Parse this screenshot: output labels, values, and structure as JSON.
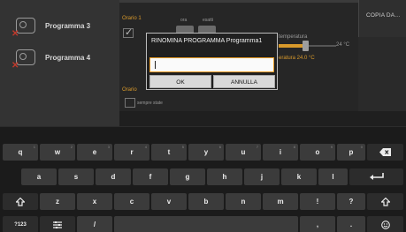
{
  "programs": [
    {
      "name": "Programma 3"
    },
    {
      "name": "Programma 4"
    }
  ],
  "settings": {
    "orario1_label": "Orario 1",
    "ora_label": "ora",
    "esatti_label": "esatti",
    "temperatura_label": "temperatura",
    "temp_value": "24 °C",
    "temperatura_value_label": "eratura 24.0 °C",
    "orario2_label": "Orario",
    "schedule_label": "sempre state"
  },
  "copy_button": {
    "label": "COPIA DA..."
  },
  "dialog": {
    "title": "RINOMINA PROGRAMMA Programma1",
    "input_value": "",
    "ok_label": "OK",
    "cancel_label": "ANNULLA"
  },
  "keyboard": {
    "row1": [
      {
        "k": "q",
        "h": "1"
      },
      {
        "k": "w",
        "h": "2"
      },
      {
        "k": "e",
        "h": "3"
      },
      {
        "k": "r",
        "h": "4"
      },
      {
        "k": "t",
        "h": "5"
      },
      {
        "k": "y",
        "h": "6"
      },
      {
        "k": "u",
        "h": "7"
      },
      {
        "k": "i",
        "h": "8"
      },
      {
        "k": "o",
        "h": "9"
      },
      {
        "k": "p",
        "h": "0"
      }
    ],
    "row2": [
      "a",
      "s",
      "d",
      "f",
      "g",
      "h",
      "j",
      "k",
      "l"
    ],
    "row3": [
      "z",
      "x",
      "c",
      "v",
      "b",
      "n",
      "m",
      "!",
      "?"
    ],
    "symbols_label": "?123",
    "slash_label": "/",
    "comma_label": ",",
    "period_label": "."
  },
  "icons": {
    "backspace": "backspace-icon",
    "enter": "enter-icon",
    "shift": "shift-icon",
    "emoji": "emoji-icon",
    "settings": "keyboard-settings-icon",
    "program": "program-icon"
  },
  "colors": {
    "accent": "#e79a23",
    "label": "#d99a2b",
    "delete_mark": "#c0392b"
  }
}
